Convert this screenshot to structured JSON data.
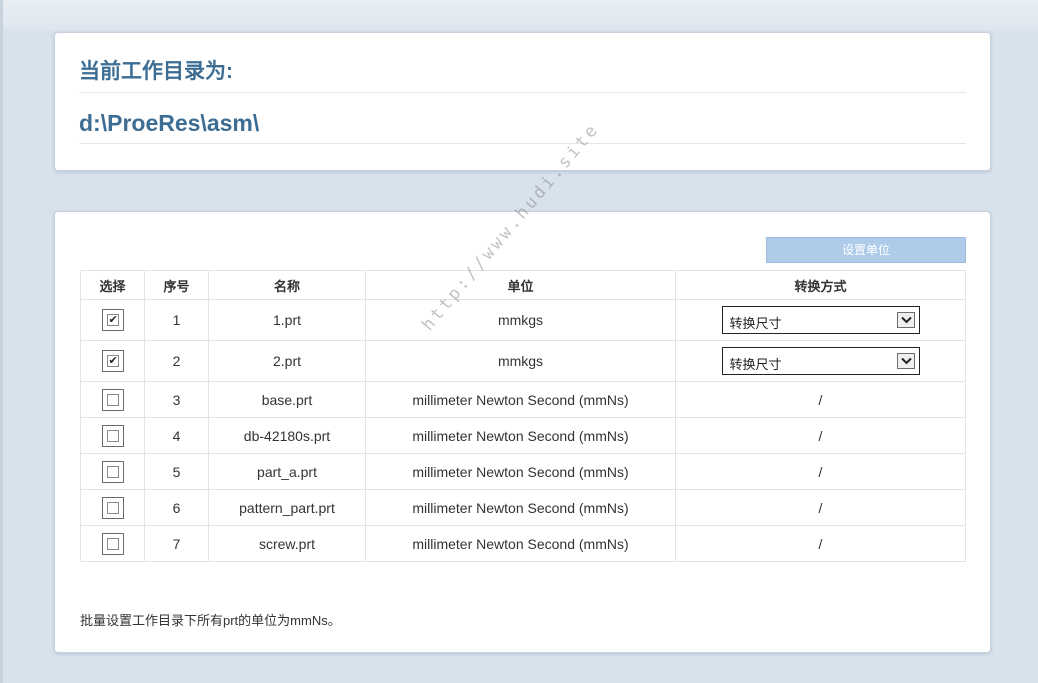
{
  "header": {
    "label": "当前工作目录为:",
    "path": "d:\\ProeRes\\asm\\"
  },
  "toolbar": {
    "set_unit_label": "设置单位"
  },
  "table": {
    "columns": [
      "选择",
      "序号",
      "名称",
      "单位",
      "转换方式"
    ],
    "rows": [
      {
        "checked": true,
        "index": "1",
        "name": "1.prt",
        "unit": "mmkgs",
        "convert": "转换尺寸"
      },
      {
        "checked": true,
        "index": "2",
        "name": "2.prt",
        "unit": "mmkgs",
        "convert": "转换尺寸"
      },
      {
        "checked": false,
        "index": "3",
        "name": "base.prt",
        "unit": "millimeter Newton Second (mmNs)",
        "convert": "/"
      },
      {
        "checked": false,
        "index": "4",
        "name": "db-42180s.prt",
        "unit": "millimeter Newton Second (mmNs)",
        "convert": "/"
      },
      {
        "checked": false,
        "index": "5",
        "name": "part_a.prt",
        "unit": "millimeter Newton Second (mmNs)",
        "convert": "/"
      },
      {
        "checked": false,
        "index": "6",
        "name": "pattern_part.prt",
        "unit": "millimeter Newton Second (mmNs)",
        "convert": "/"
      },
      {
        "checked": false,
        "index": "7",
        "name": "screw.prt",
        "unit": "millimeter Newton Second (mmNs)",
        "convert": "/"
      }
    ]
  },
  "footer": {
    "note": "批量设置工作目录下所有prt的单位为mmNs。"
  },
  "watermark": "http://www.hudi.site",
  "colors": {
    "heading": "#3d6d93",
    "button_bg": "#aecbea",
    "page_bg": "#d8e2ec"
  }
}
